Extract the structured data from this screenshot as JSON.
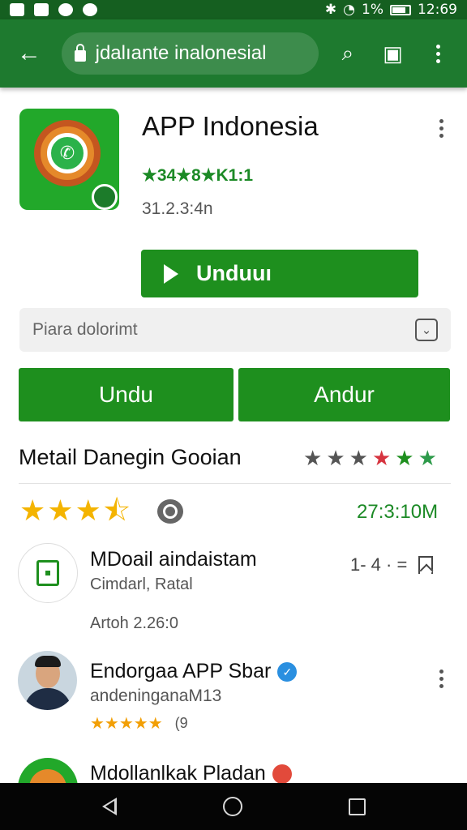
{
  "status_bar": {
    "time": "12:69",
    "battery_text": "1%",
    "icons": [
      "gallery-icon",
      "shield-icon",
      "chat-icon",
      "location-icon",
      "bluetooth-icon",
      "wifi-icon",
      "signal-icon",
      "battery-icon"
    ]
  },
  "browser": {
    "url": "jdalıante inalonesial",
    "icons": [
      "back-arrow-icon",
      "lock-icon",
      "search-icon",
      "tab-icon",
      "more-vert-icon"
    ]
  },
  "app": {
    "title": "APP Indonesia",
    "rating_text": "★34★8★K1:1",
    "meta": "31.2.3:4n",
    "install_label": "Unduuı"
  },
  "search": {
    "placeholder": "Piara dolorimt"
  },
  "buttons": {
    "left_label": "Undu",
    "right_label": "Andur"
  },
  "section": {
    "title": "Metail Danegin Gooian",
    "stars": [
      {
        "glyph": "★",
        "color": "#555555"
      },
      {
        "glyph": "★",
        "color": "#555555"
      },
      {
        "glyph": "★",
        "color": "#555555"
      },
      {
        "glyph": "★",
        "color": "#d6343f"
      },
      {
        "glyph": "★",
        "color": "#1e8f1e"
      },
      {
        "glyph": "★",
        "color": "#2d9a4a"
      }
    ]
  },
  "rating_row": {
    "stars_glyphs": [
      "★",
      "★",
      "★",
      "⯪"
    ],
    "count": "27:3:10M"
  },
  "list": [
    {
      "title": "MDoail aindaistam",
      "subtitle": "Cimdarl, Ratal",
      "version": "Artoh 2.26:0",
      "action_text": "1- 4 · ="
    },
    {
      "title": "Endorgaa APP Sbar",
      "subtitle": "andeninganaM13",
      "stars": "★★★★★",
      "count": "(9"
    },
    {
      "title": "Mdollanlkak Pladan"
    }
  ],
  "colors": {
    "primary_green": "#1e8f1e",
    "toolbar_green": "#1e7a2f",
    "status_green": "#155f20",
    "star_yellow": "#f4b400"
  }
}
